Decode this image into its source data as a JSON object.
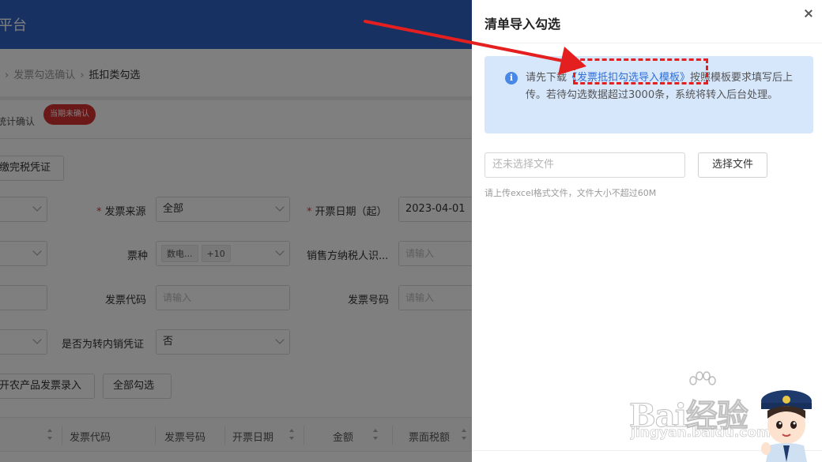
{
  "background": {
    "platform_title": "平台",
    "breadcrumb": [
      "发票勾选确认",
      "抵扣类勾选"
    ],
    "breadcrumb_sep": "›",
    "tab_label": "统计确认",
    "tab_badge": "当期未确认",
    "voucher_button": "缴完税凭证",
    "form": {
      "source_label": "发票来源",
      "source_value": "全部",
      "start_date_label": "开票日期（起）",
      "start_date_value": "2023-04-01",
      "type_label": "票种",
      "type_tag": "数电...",
      "type_more": "+10",
      "seller_label": "销售方纳税人识...",
      "seller_placeholder": "请输入",
      "code_label": "发票代码",
      "code_placeholder": "请输入",
      "number_label": "发票号码",
      "number_placeholder": "请输入",
      "transfer_label": "是否为转内销凭证",
      "transfer_value": "否"
    },
    "actions": {
      "agri_button": "开农产品发票录入",
      "select_all_button": "全部勾选"
    },
    "table_headers": [
      "发票代码",
      "发票号码",
      "开票日期",
      "金额",
      "票面税额"
    ]
  },
  "drawer": {
    "title": "清单导入勾选",
    "notice": {
      "prefix": "请先下载",
      "link": "《发票抵扣勾选导入模板》",
      "suffix": "按照模板要求填写后上传。若待勾选数据超过3000条，系统将转入后台处理。"
    },
    "file_placeholder": "还未选择文件",
    "choose_button": "选择文件",
    "hint": "请上传excel格式文件，文件大小不超过60M"
  },
  "watermark": {
    "brand": "Bai经验",
    "url": "jingyan.baidu.com"
  },
  "colors": {
    "header_blue": "#2f63c4",
    "info_bg": "#d6e6fb",
    "link_blue": "#2e6fd8",
    "annotation_red": "#e41f1f",
    "badge_red": "#d43030"
  }
}
